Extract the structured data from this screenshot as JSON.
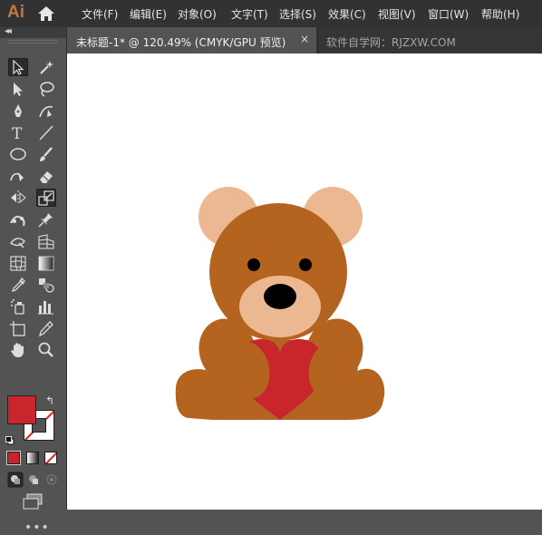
{
  "app": {
    "logo": "Ai"
  },
  "menu": [
    {
      "label": "文件(F)"
    },
    {
      "label": "编辑(E)"
    },
    {
      "label": "对象(O)"
    },
    {
      "label": "文字(T)"
    },
    {
      "label": "选择(S)"
    },
    {
      "label": "效果(C)"
    },
    {
      "label": "视图(V)"
    },
    {
      "label": "窗口(W)"
    },
    {
      "label": "帮助(H)"
    }
  ],
  "tabs": {
    "active": {
      "label": "未标题-1* @ 120.49% (CMYK/GPU 预览)",
      "close": "×"
    },
    "inactive": {
      "label": "软件自学网：RJZXW.COM"
    }
  },
  "toolbar": {
    "collapse": "◂◂",
    "tools": [
      "selection-tool",
      "magic-wand-tool",
      "direct-selection-tool",
      "lasso-tool",
      "pen-tool",
      "curvature-tool",
      "type-tool",
      "line-segment-tool",
      "ellipse-tool",
      "paintbrush-tool",
      "shaper-tool",
      "eraser-tool",
      "reflect-tool",
      "scale-tool",
      "puppet-warp-tool",
      "pin-tool",
      "free-transform-tool",
      "perspective-grid-tool",
      "mesh-tool",
      "gradient-tool",
      "eyedropper-tool",
      "blend-tool",
      "symbol-sprayer-tool",
      "column-graph-tool",
      "artboard-tool",
      "slice-tool",
      "hand-tool",
      "zoom-tool"
    ],
    "active_tools": [
      "selection-tool",
      "scale-tool"
    ],
    "more": "•••"
  },
  "colors": {
    "fill": "#c9252d",
    "stroke": "none",
    "swap_icon": "↰"
  },
  "artwork": {
    "ears": "#ebb892",
    "fur": "#b4641f",
    "muzzle": "#ebb892",
    "nose_and_eyes": "#000000",
    "heart": "#c9252d"
  }
}
